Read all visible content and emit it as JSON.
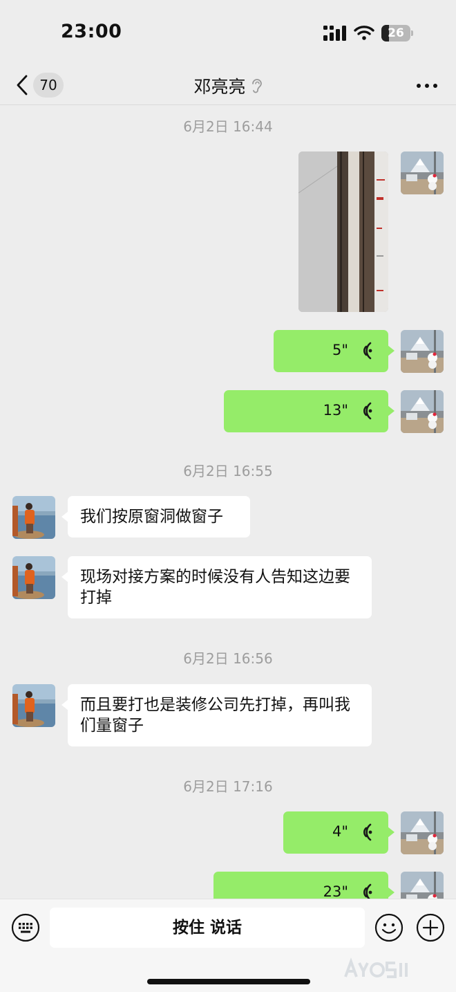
{
  "status_bar": {
    "time": "23:00",
    "battery_level": "26",
    "battery_fraction": 0.26
  },
  "nav": {
    "unread_count": "70",
    "title": "邓亮亮"
  },
  "messages": {
    "ts1": "6月2日 16:44",
    "voice1_duration": "5\"",
    "voice2_duration": "13\"",
    "ts2": "6月2日 16:55",
    "text1": "我们按原窗洞做窗子",
    "text2": "现场对接方案的时候没有人告知这边要打掉",
    "ts3": "6月2日 16:56",
    "text3": "而且要打也是装修公司先打掉，再叫我们量窗子",
    "ts4": "6月2日 17:16",
    "voice3_duration": "4\"",
    "voice4_duration": "23\""
  },
  "input_bar": {
    "hold_to_talk_label": "按住 说话"
  },
  "icons": {
    "back": "chevron-left-icon",
    "earpiece": "ear-icon",
    "more": "more-dots-icon",
    "voice": "voice-wave-icon",
    "keyboard": "keyboard-icon",
    "emoji": "emoji-icon",
    "plus": "plus-icon"
  },
  "colors": {
    "self_bubble": "#95ec69",
    "other_bubble": "#ffffff",
    "background": "#ededed",
    "timestamp": "#9d9d9d"
  }
}
